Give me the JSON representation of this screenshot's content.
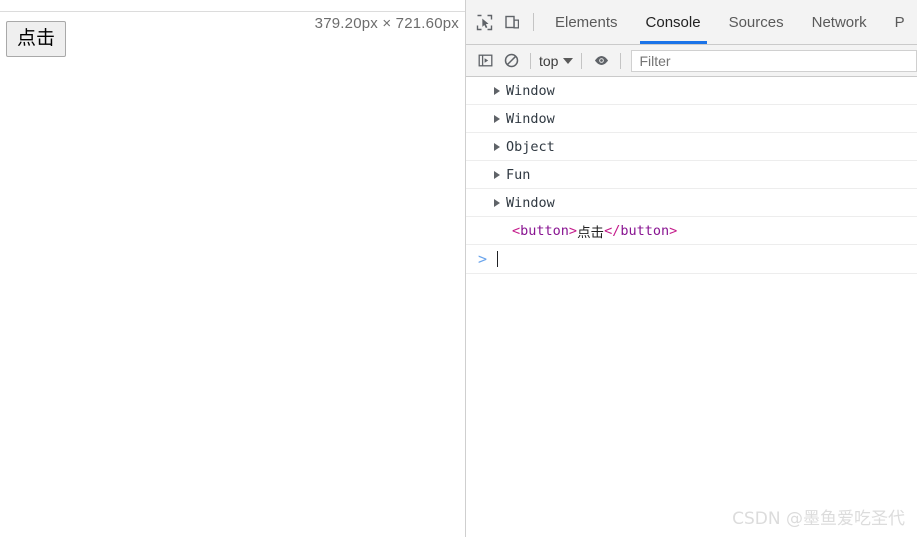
{
  "page": {
    "button_label": "点击",
    "dimensions_badge": "379.20px × 721.60px"
  },
  "devtools": {
    "icons": {
      "inspect": "inspect-element-icon",
      "device": "device-toolbar-icon",
      "sidebar": "console-sidebar-icon",
      "clear": "clear-console-icon",
      "eye": "live-expression-eye-icon"
    },
    "tabs": [
      {
        "label": "Elements",
        "active": false
      },
      {
        "label": "Console",
        "active": true
      },
      {
        "label": "Sources",
        "active": false
      },
      {
        "label": "Network",
        "active": false
      },
      {
        "label": "P",
        "active": false
      }
    ],
    "console_toolbar": {
      "context_label": "top",
      "filter_placeholder": "Filter"
    },
    "log_rows": [
      {
        "type": "object",
        "label": "Window"
      },
      {
        "type": "object",
        "label": "Window"
      },
      {
        "type": "object",
        "label": "Object"
      },
      {
        "type": "object",
        "label": "Fun"
      },
      {
        "type": "object",
        "label": "Window"
      },
      {
        "type": "element",
        "open_bracket": "<",
        "open_name": "button",
        "close_bracket1": ">",
        "text": "点击",
        "close_bracket2": "</",
        "close_name": "button",
        "close_bracket3": ">"
      }
    ],
    "prompt": {
      "chevron": ">",
      "value": ""
    },
    "watermark": "CSDN @墨鱼爱吃圣代"
  },
  "colors": {
    "accent": "#1a73e8",
    "tag_bracket": "#c41a8a",
    "tag_name": "#881391",
    "toolbar_bg": "#f3f3f3"
  }
}
